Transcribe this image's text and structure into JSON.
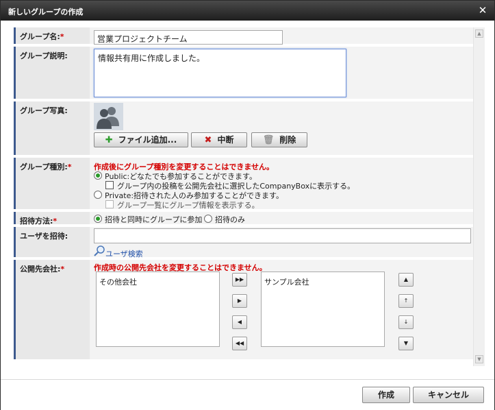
{
  "dialog": {
    "title": "新しいグループの作成",
    "close_glyph": "✕"
  },
  "labels": {
    "group_name": "グループ名:",
    "group_desc": "グループ説明:",
    "group_photo": "グループ写真:",
    "group_type": "グループ種別:",
    "invite_method": "招待方法:",
    "invite_users": "ユーザを招待:",
    "publish_company": "公開先会社:",
    "required_mark": "*"
  },
  "fields": {
    "group_name_value": "営業プロジェクトチーム",
    "group_desc_value": "情報共有用に作成しました。",
    "invite_user_value": ""
  },
  "photo": {
    "add_file": "ファイル追加...",
    "cancel": "中断",
    "delete": "削除"
  },
  "group_type": {
    "warning": "作成後にグループ種別を変更することはできません。",
    "public_label": "Public:どなたでも参加することができます。",
    "public_option": "グループ内の投稿を公開先会社に選択したCompanyBoxに表示する。",
    "private_label": "Private:招待された人のみ参加することができます。",
    "private_option": "グループ一覧にグループ情報を表示する。",
    "selected": "public"
  },
  "invite": {
    "opt1": "招待と同時にグループに参加",
    "opt2": "招待のみ",
    "selected": "opt1",
    "user_search": "ユーザ検索"
  },
  "company": {
    "warning": "作成時の公開先会社を変更することはできません。",
    "available": [
      "その他会社"
    ],
    "selected": [
      "サンプル会社"
    ],
    "move_all_right": "▶▶",
    "move_right": "▶",
    "move_left": "◀",
    "move_all_left": "◀◀",
    "order_top": "▲",
    "order_up": "↑",
    "order_down": "↓",
    "order_bottom": "▼"
  },
  "footer": {
    "create": "作成",
    "cancel": "キャンセル"
  },
  "colors": {
    "accent": "#3e5a8e",
    "warning": "#d40000",
    "radio_on": "#2a9a2a"
  }
}
